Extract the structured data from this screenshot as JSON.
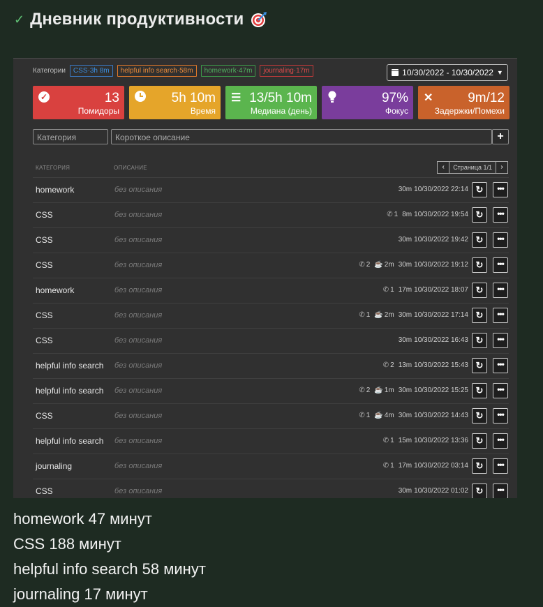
{
  "header": {
    "title": "Дневник продуктивности"
  },
  "categories": {
    "label": "Категории",
    "chips": [
      "CSS·3h 8m",
      "helpful info search·58m",
      "homework·47m",
      "journaling·17m"
    ]
  },
  "date_range": "10/30/2022 - 10/30/2022",
  "stats": [
    {
      "value": "13",
      "label": "Помидоры",
      "icon": "check-circle-icon"
    },
    {
      "value": "5h 10m",
      "label": "Время",
      "icon": "clock-icon"
    },
    {
      "value": "13/5h 10m",
      "label": "Медиана (день)",
      "icon": "list-icon"
    },
    {
      "value": "97%",
      "label": "Фокус",
      "icon": "bulb-icon"
    },
    {
      "value": "9m/12",
      "label": "Задержки/Помехи",
      "icon": "close-icon"
    }
  ],
  "inputs": {
    "category_placeholder": "Категория",
    "description_placeholder": "Короткое описание"
  },
  "table": {
    "col_category": "КАТЕГОРИЯ",
    "col_description": "ОПИСАНИЕ",
    "page": "Страница 1/1",
    "rows": [
      {
        "cat": "homework",
        "desc": "без описания",
        "calls": "",
        "breaks": "",
        "dur": "30m",
        "time": "10/30/2022 22:14"
      },
      {
        "cat": "CSS",
        "desc": "без описания",
        "calls": "1",
        "breaks": "",
        "dur": "8m",
        "time": "10/30/2022 19:54"
      },
      {
        "cat": "CSS",
        "desc": "без описания",
        "calls": "",
        "breaks": "",
        "dur": "30m",
        "time": "10/30/2022 19:42"
      },
      {
        "cat": "CSS",
        "desc": "без описания",
        "calls": "2",
        "breaks": "2m",
        "dur": "30m",
        "time": "10/30/2022 19:12"
      },
      {
        "cat": "homework",
        "desc": "без описания",
        "calls": "1",
        "breaks": "",
        "dur": "17m",
        "time": "10/30/2022 18:07"
      },
      {
        "cat": "CSS",
        "desc": "без описания",
        "calls": "1",
        "breaks": "2m",
        "dur": "30m",
        "time": "10/30/2022 17:14"
      },
      {
        "cat": "CSS",
        "desc": "без описания",
        "calls": "",
        "breaks": "",
        "dur": "30m",
        "time": "10/30/2022 16:43"
      },
      {
        "cat": "helpful info search",
        "desc": "без описания",
        "calls": "2",
        "breaks": "",
        "dur": "13m",
        "time": "10/30/2022 15:43"
      },
      {
        "cat": "helpful info search",
        "desc": "без описания",
        "calls": "2",
        "breaks": "1m",
        "dur": "30m",
        "time": "10/30/2022 15:25"
      },
      {
        "cat": "CSS",
        "desc": "без описания",
        "calls": "1",
        "breaks": "4m",
        "dur": "30m",
        "time": "10/30/2022 14:43"
      },
      {
        "cat": "helpful info search",
        "desc": "без описания",
        "calls": "1",
        "breaks": "",
        "dur": "15m",
        "time": "10/30/2022 13:36"
      },
      {
        "cat": "journaling",
        "desc": "без описания",
        "calls": "1",
        "breaks": "",
        "dur": "17m",
        "time": "10/30/2022 03:14"
      },
      {
        "cat": "CSS",
        "desc": "без описания",
        "calls": "",
        "breaks": "",
        "dur": "30m",
        "time": "10/30/2022 01:02"
      }
    ]
  },
  "summary": [
    "homework 47 минут",
    "CSS 188 минут",
    "helpful info search 58 минут",
    "journaling 17 минут"
  ]
}
